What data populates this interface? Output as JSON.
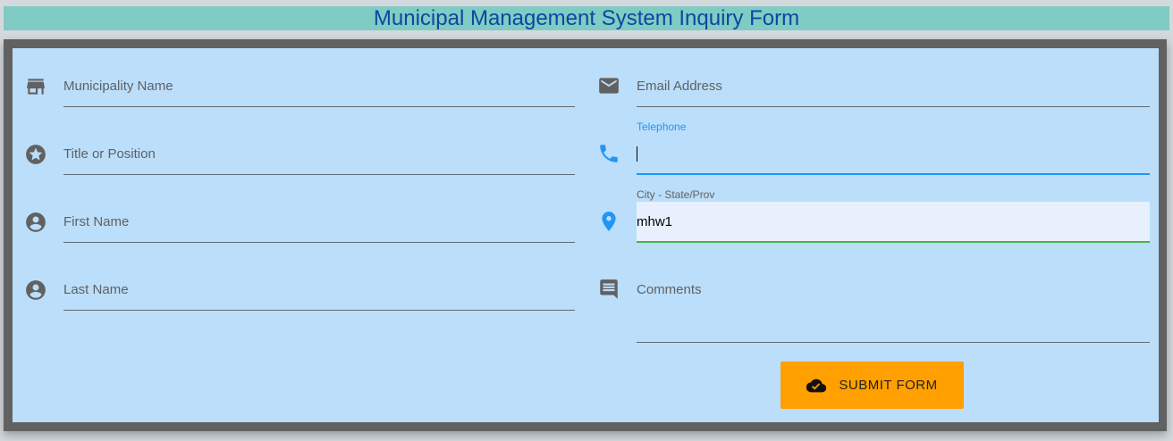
{
  "title": "Municipal Management System Inquiry Form",
  "left_fields": [
    {
      "icon": "store-icon",
      "placeholder": "Municipality Name"
    },
    {
      "icon": "star-icon",
      "placeholder": "Title or Position"
    },
    {
      "icon": "account-icon",
      "placeholder": "First Name"
    },
    {
      "icon": "account-icon",
      "placeholder": "Last Name"
    }
  ],
  "right_fields": {
    "email": {
      "icon": "email-icon",
      "placeholder": "Email Address"
    },
    "telephone": {
      "icon": "phone-icon",
      "label": "Telephone",
      "value": ""
    },
    "city": {
      "icon": "location-pin-icon",
      "label": "City - State/Prov",
      "value": "mhw1"
    },
    "comments": {
      "icon": "comment-icon",
      "placeholder": "Comments"
    }
  },
  "submit": {
    "icon": "cloud-done-icon",
    "label": "SUBMIT FORM"
  },
  "colors": {
    "accent": "#2196f3",
    "valid": "#4caf50",
    "button": "#ffa000",
    "title": "#0d47a1",
    "header_bg": "#80cbc4",
    "form_bg": "#bbdefb"
  }
}
